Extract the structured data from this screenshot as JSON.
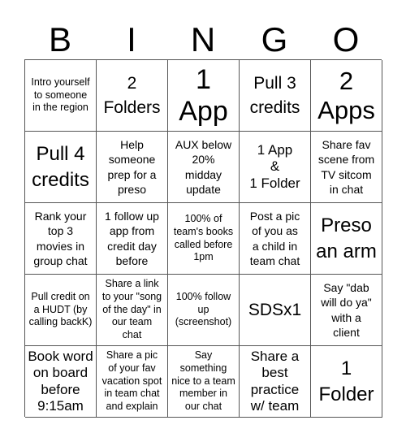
{
  "header": {
    "letters": [
      "B",
      "I",
      "N",
      "G",
      "O"
    ]
  },
  "board": {
    "cells": [
      [
        "Intro yourself\nto someone\nin the region",
        "2\nFolders",
        "1\nApp",
        "Pull 3\ncredits",
        "2\nApps"
      ],
      [
        "Pull 4\ncredits",
        "Help\nsomeone\nprep for a\npreso",
        "AUX below\n20%\nmidday\nupdate",
        "1 App\n&\n1 Folder",
        "Share fav\nscene from\nTV sitcom\nin chat"
      ],
      [
        "Rank your\ntop 3\nmovies in\ngroup chat",
        "1 follow up\napp from\ncredit day\nbefore",
        "100% of\nteam's books\ncalled before\n1pm",
        "Post a pic\nof you as\na child in\nteam chat",
        "Preso\nan arm"
      ],
      [
        "Pull credit on\na HUDT (by\ncalling backK)",
        "Share a link\nto your \"song\nof the day\" in\nour team\nchat",
        "100% follow\nup\n(screenshot)",
        "SDSx1",
        "Say \"dab\nwill do ya\"\nwith a\nclient"
      ],
      [
        "Book word\non board\nbefore\n9:15am",
        "Share a pic\nof your fav\nvacation spot\nin team chat\nand explain",
        "Say\nsomething\nnice to a team\nmember in\nour chat",
        "Share a\nbest\npractice\nw/ team",
        "1\nFolder"
      ]
    ]
  }
}
